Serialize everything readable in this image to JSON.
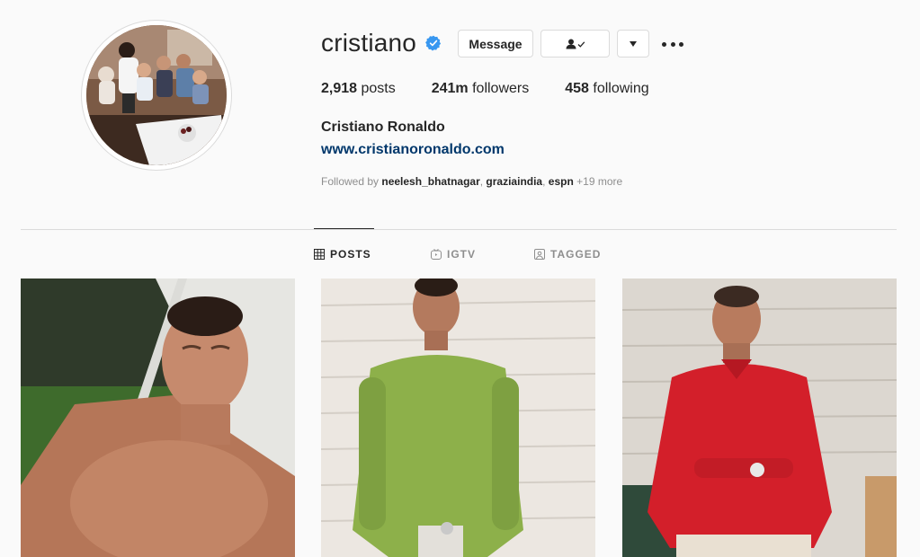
{
  "profile": {
    "username": "cristiano",
    "verified": true,
    "buttons": {
      "message": "Message",
      "follow_icon": "person-check-icon",
      "dropdown_icon": "caret-down-icon",
      "more_icon": "more-horizontal-icon"
    },
    "stats": {
      "posts_count": "2,918",
      "posts_label": " posts",
      "followers_count": "241m",
      "followers_label": " followers",
      "following_count": "458",
      "following_label": " following"
    },
    "full_name": "Cristiano Ronaldo",
    "website": "www.cristianoronaldo.com",
    "followed_by": {
      "prefix": "Followed by ",
      "users": [
        "neelesh_bhatnagar",
        "graziaindia",
        "espn"
      ],
      "separator": ", ",
      "more": " +19 more"
    }
  },
  "tabs": [
    {
      "label": "POSTS",
      "icon": "grid-icon",
      "active": true
    },
    {
      "label": "IGTV",
      "icon": "igtv-icon",
      "active": false
    },
    {
      "label": "TAGGED",
      "icon": "tagged-icon",
      "active": false
    }
  ],
  "posts": [
    {
      "icon": "photo-shirtless-sunbathing"
    },
    {
      "icon": "photo-green-shirt"
    },
    {
      "icon": "photo-red-shirt"
    }
  ],
  "colors": {
    "background": "#fafafa",
    "text": "#262626",
    "secondary": "#8e8e8e",
    "border": "#dbdbdb",
    "link": "#00376b",
    "verified": "#3897f0"
  }
}
